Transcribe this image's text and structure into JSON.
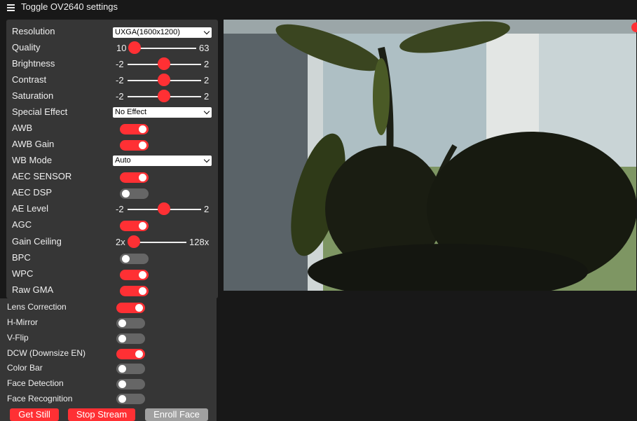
{
  "header": {
    "toggle_label": "Toggle OV2640 settings"
  },
  "colors": {
    "accent": "#ff3034",
    "panel": "#363636",
    "background": "#181818",
    "toggle_off": "#666666"
  },
  "resolution": {
    "label": "Resolution",
    "value": "UXGA(1600x1200)"
  },
  "quality": {
    "label": "Quality",
    "min": "10",
    "max": "63",
    "value": 10
  },
  "brightness": {
    "label": "Brightness",
    "min": "-2",
    "max": "2",
    "value": 0
  },
  "contrast": {
    "label": "Contrast",
    "min": "-2",
    "max": "2",
    "value": 0
  },
  "saturation": {
    "label": "Saturation",
    "min": "-2",
    "max": "2",
    "value": 0
  },
  "special_effect": {
    "label": "Special Effect",
    "value": "No Effect"
  },
  "awb": {
    "label": "AWB",
    "on": true
  },
  "awb_gain": {
    "label": "AWB Gain",
    "on": true
  },
  "wb_mode": {
    "label": "WB Mode",
    "value": "Auto"
  },
  "aec_sensor": {
    "label": "AEC SENSOR",
    "on": true
  },
  "aec_dsp": {
    "label": "AEC DSP",
    "on": false
  },
  "ae_level": {
    "label": "AE Level",
    "min": "-2",
    "max": "2",
    "value": 0
  },
  "agc": {
    "label": "AGC",
    "on": true
  },
  "gain_ceiling": {
    "label": "Gain Ceiling",
    "min": "2x",
    "max": "128x",
    "value": 0
  },
  "bpc": {
    "label": "BPC",
    "on": false
  },
  "wpc": {
    "label": "WPC",
    "on": true
  },
  "raw_gma": {
    "label": "Raw GMA",
    "on": true
  },
  "lens_correction": {
    "label": "Lens Correction",
    "on": true
  },
  "h_mirror": {
    "label": "H-Mirror",
    "on": false
  },
  "v_flip": {
    "label": "V-Flip",
    "on": false
  },
  "dcw": {
    "label": "DCW (Downsize EN)",
    "on": true
  },
  "color_bar": {
    "label": "Color Bar",
    "on": false
  },
  "face_detection": {
    "label": "Face Detection",
    "on": false
  },
  "face_recognition": {
    "label": "Face Recognition",
    "on": false
  },
  "buttons": {
    "get_still": "Get Still",
    "stop_stream": "Stop Stream",
    "enroll_face": "Enroll Face"
  }
}
